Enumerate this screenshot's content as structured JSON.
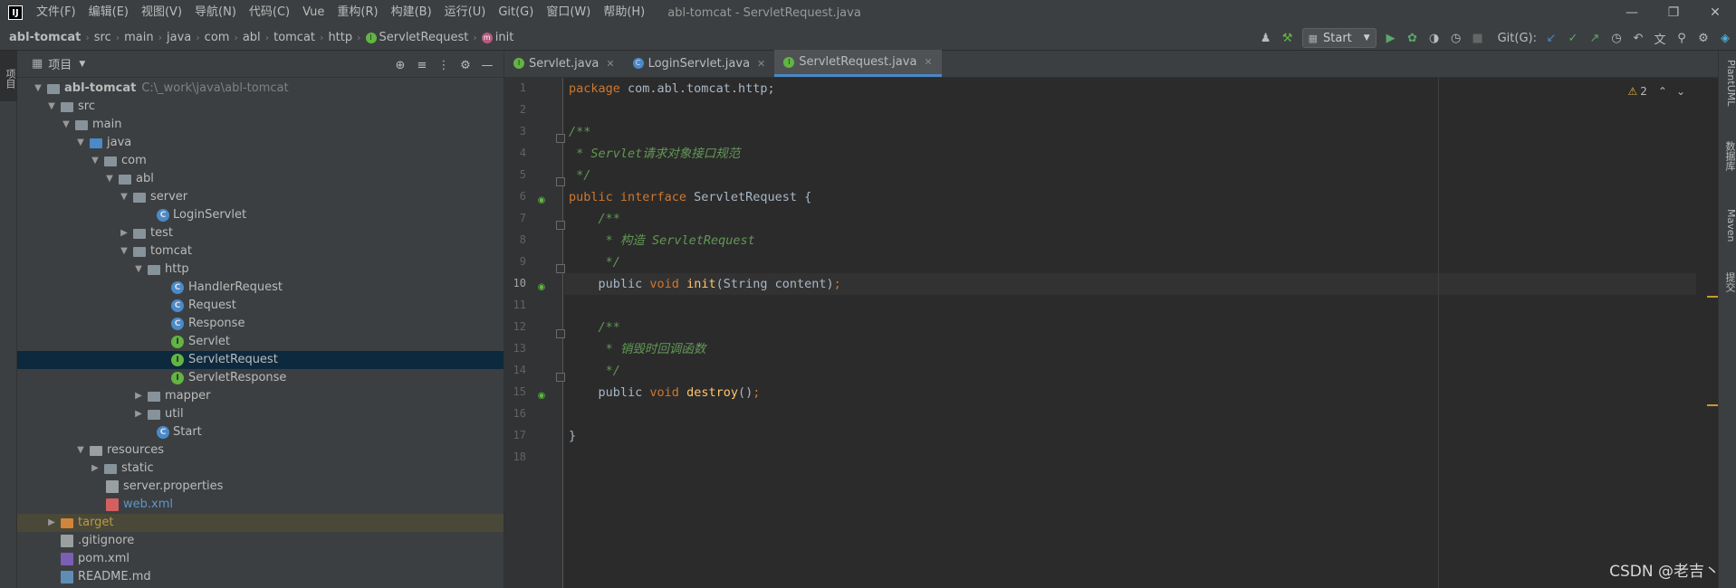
{
  "titlebar": {
    "menu": [
      "文件(F)",
      "编辑(E)",
      "视图(V)",
      "导航(N)",
      "代码(C)",
      "Vue",
      "重构(R)",
      "构建(B)",
      "运行(U)",
      "Git(G)",
      "窗口(W)",
      "帮助(H)"
    ],
    "window_title": "abl-tomcat - ServletRequest.java"
  },
  "breadcrumb": [
    "abl-tomcat",
    "src",
    "main",
    "java",
    "com",
    "abl",
    "tomcat",
    "http",
    "ServletRequest",
    "init"
  ],
  "toolbar": {
    "run_config": "Start",
    "git_label": "Git(G):"
  },
  "left_strip": {
    "project_tab": "项目"
  },
  "project_panel": {
    "title": "项目",
    "root_name": "abl-tomcat",
    "root_path": "C:\\_work\\java\\abl-tomcat",
    "items": [
      "src",
      "main",
      "java",
      "com",
      "abl",
      "server",
      "LoginServlet",
      "test",
      "tomcat",
      "http",
      "HandlerRequest",
      "Request",
      "Response",
      "Servlet",
      "ServletRequest",
      "ServletResponse",
      "mapper",
      "util",
      "Start",
      "resources",
      "static",
      "server.properties",
      "web.xml",
      "target",
      ".gitignore",
      "pom.xml",
      "README.md"
    ]
  },
  "tabs": [
    "Servlet.java",
    "LoginServlet.java",
    "ServletRequest.java"
  ],
  "editor": {
    "line_numbers": [
      "1",
      "2",
      "3",
      "4",
      "5",
      "6",
      "7",
      "8",
      "9",
      "10",
      "11",
      "12",
      "13",
      "14",
      "15",
      "16",
      "17",
      "18"
    ],
    "warnings": "2",
    "code": {
      "l1_kw": "package",
      "l1_rest": " com.abl.tomcat.http;",
      "l3": "/**",
      "l4": " * Servlet请求对象接口规范",
      "l5": " */",
      "l6_kw": "public interface",
      "l6_rest": " ServletRequest {",
      "l7": "    /**",
      "l8": "     * 构造 ServletRequest",
      "l9": "     */",
      "l10_kw1": "    public",
      "l10_kw2": " void ",
      "l10_fn": "init",
      "l10_rest": "(String content)",
      "l10_end": ";",
      "l12": "    /**",
      "l13": "     * 销毁时回调函数",
      "l14": "     */",
      "l15_kw1": "    public",
      "l15_kw2": " void ",
      "l15_fn": "destroy",
      "l15_rest": "()",
      "l15_end": ";",
      "l17": "}"
    }
  },
  "right_strip": [
    "PlantUML",
    "数据库",
    "Maven",
    "提交"
  ],
  "watermark": "CSDN @老吉丶"
}
